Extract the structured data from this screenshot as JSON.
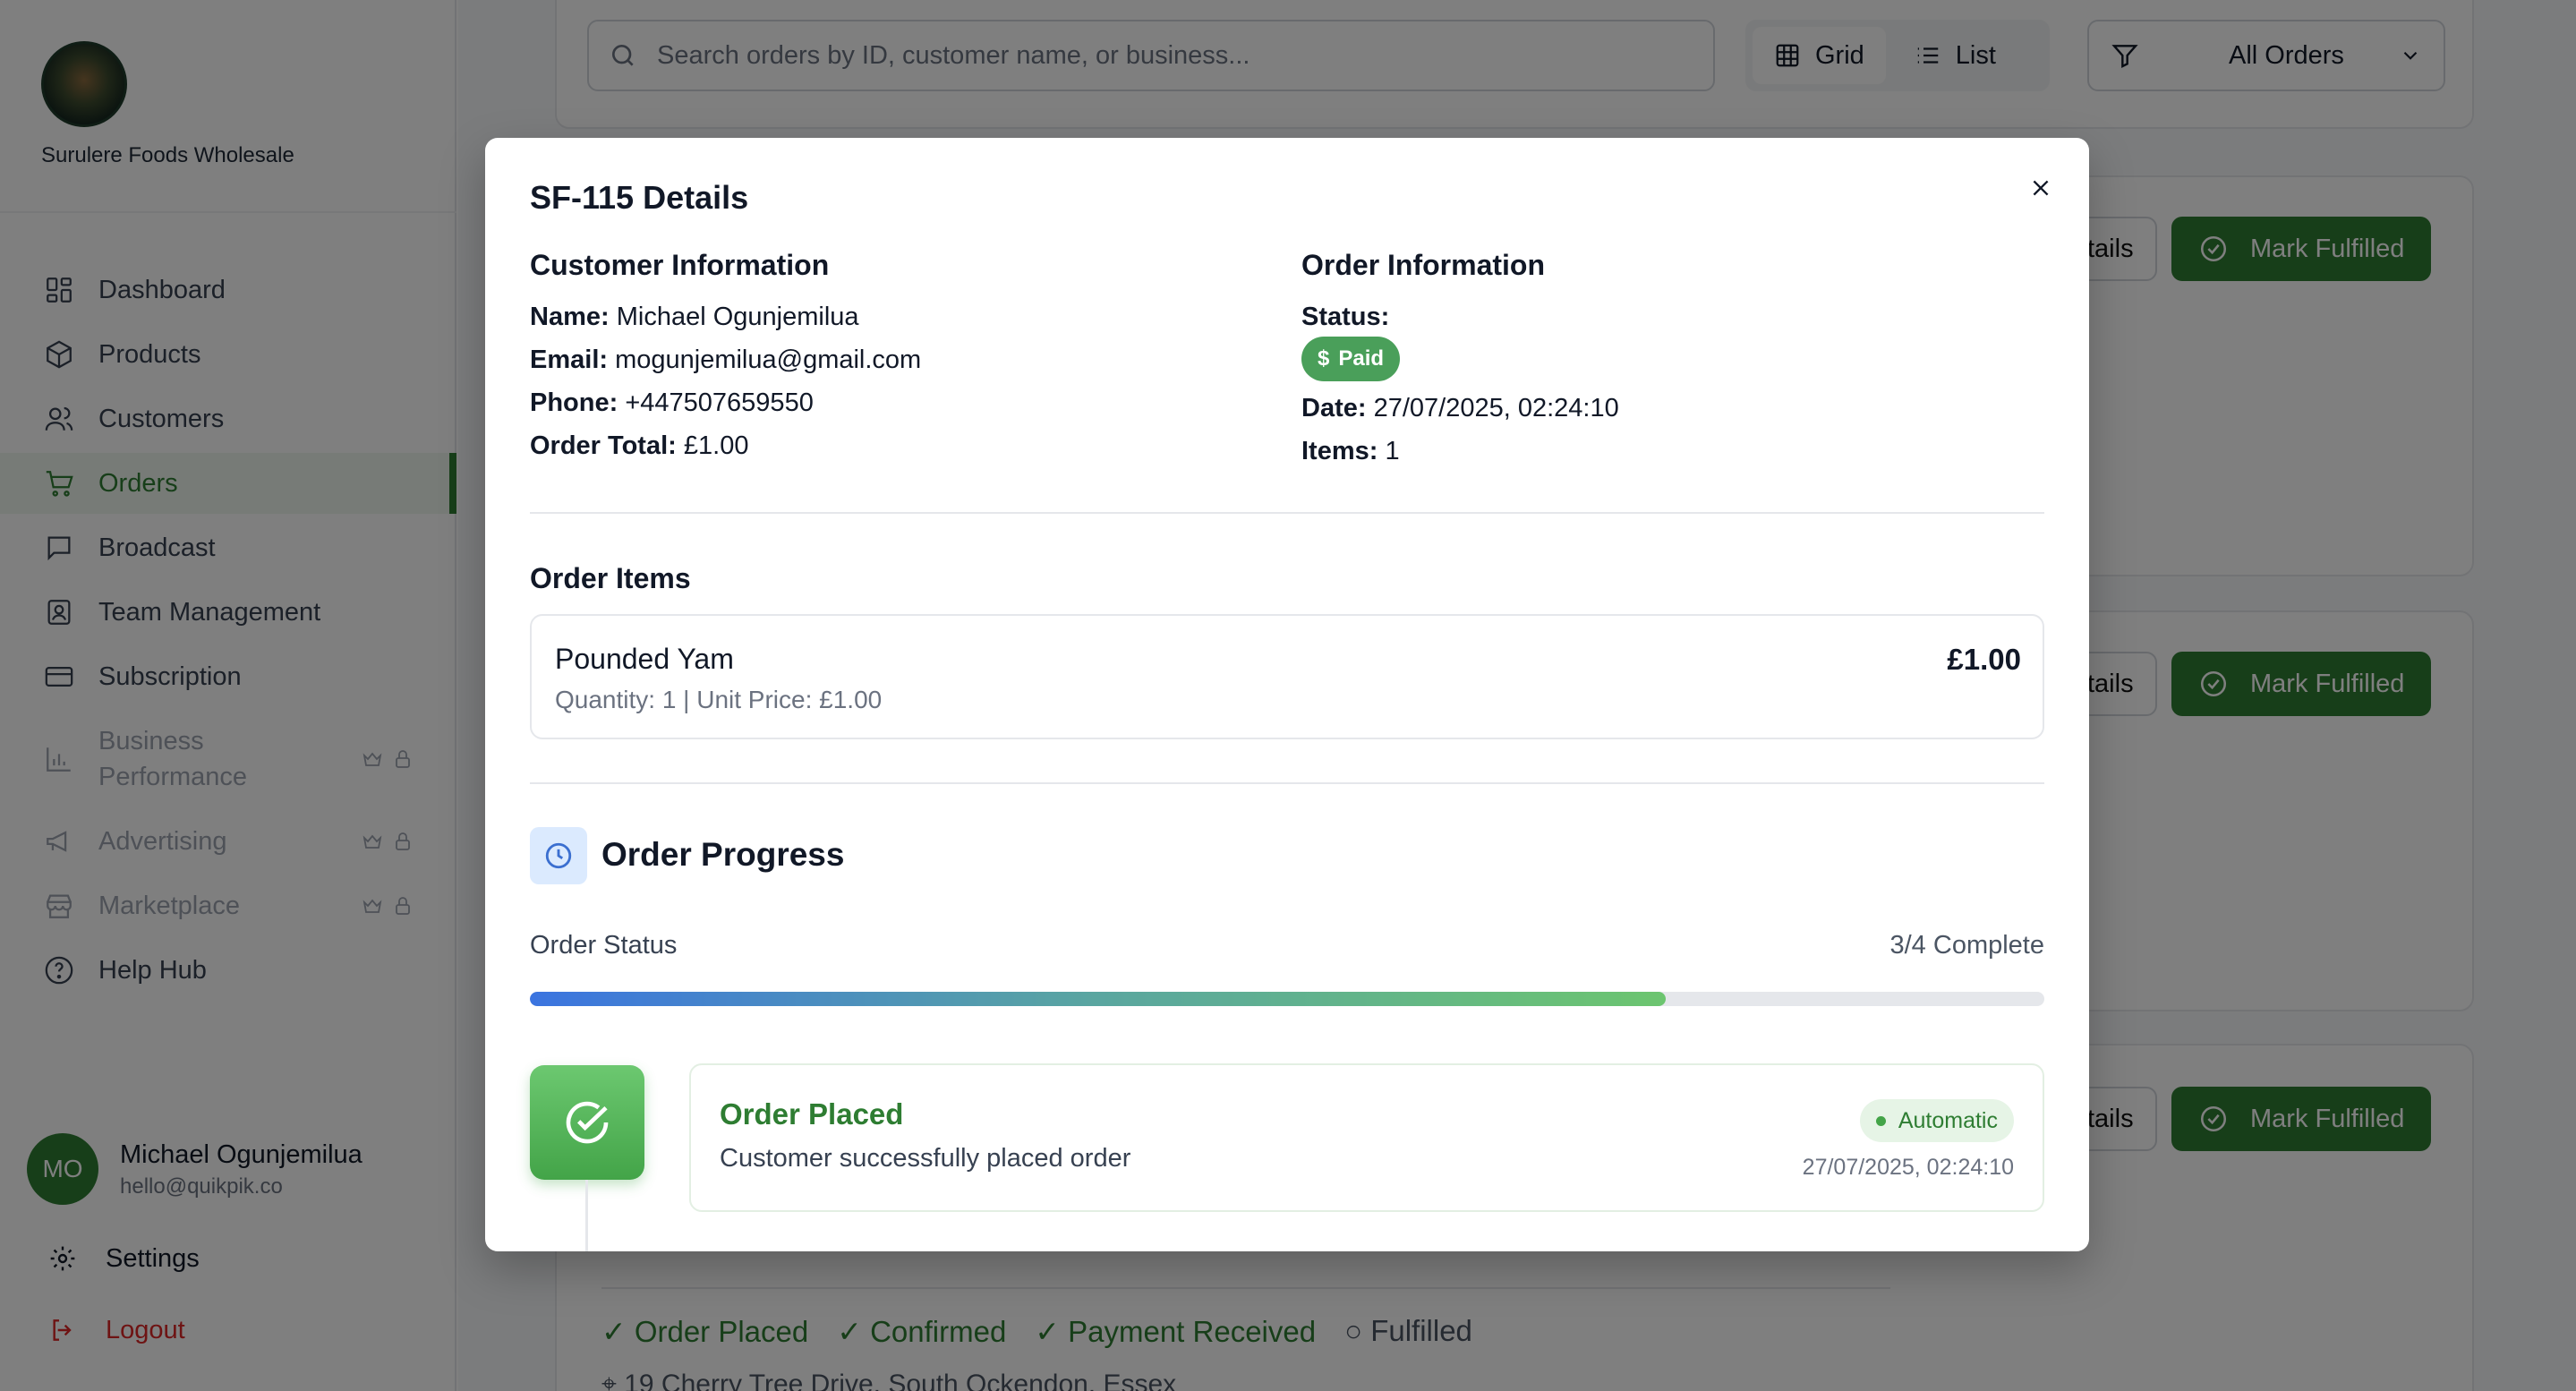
{
  "business": {
    "name": "Surulere Foods Wholesale"
  },
  "nav": {
    "items": [
      {
        "label": "Dashboard",
        "icon": "grid-icon"
      },
      {
        "label": "Products",
        "icon": "box-icon"
      },
      {
        "label": "Customers",
        "icon": "users-icon"
      },
      {
        "label": "Orders",
        "icon": "cart-icon",
        "active": true
      },
      {
        "label": "Broadcast",
        "icon": "message-icon"
      },
      {
        "label": "Team Management",
        "icon": "id-card-icon"
      },
      {
        "label": "Subscription",
        "icon": "credit-card-icon"
      },
      {
        "label": "Business Performance",
        "icon": "bar-chart-icon",
        "locked": true
      },
      {
        "label": "Advertising",
        "icon": "megaphone-icon",
        "locked": true
      },
      {
        "label": "Marketplace",
        "icon": "store-icon",
        "locked": true
      },
      {
        "label": "Help Hub",
        "icon": "help-circle-icon"
      }
    ]
  },
  "user": {
    "initials": "MO",
    "name": "Michael Ogunjemilua",
    "email": "hello@quikpik.co"
  },
  "footer": {
    "settings": "Settings",
    "logout": "Logout"
  },
  "toolbar": {
    "search_placeholder": "Search orders by ID, customer name, or business...",
    "grid_label": "Grid",
    "list_label": "List",
    "filter_value": "All Orders"
  },
  "background_orders": {
    "details_label": "tails",
    "fulfill_label": "Mark Fulfilled",
    "progress_steps": [
      "✓ Order Placed",
      "✓ Confirmed",
      "✓ Payment Received",
      "○ Fulfilled"
    ],
    "address": "⌖ 19 Cherry Tree Drive, South Ockendon, Essex"
  },
  "modal": {
    "title": "SF-115 Details",
    "customer": {
      "heading": "Customer Information",
      "name_label": "Name:",
      "name": "Michael Ogunjemilua",
      "email_label": "Email:",
      "email": "mogunjemilua@gmail.com",
      "phone_label": "Phone:",
      "phone": "+447507659550",
      "total_label": "Order Total:",
      "total": "£1.00"
    },
    "order": {
      "heading": "Order Information",
      "status_label": "Status:",
      "status": "Paid",
      "date_label": "Date:",
      "date": "27/07/2025, 02:24:10",
      "items_label": "Items:",
      "items": "1"
    },
    "items_heading": "Order Items",
    "items": [
      {
        "name": "Pounded Yam",
        "meta": "Quantity: 1 | Unit Price: £1.00",
        "price": "£1.00"
      }
    ],
    "progress": {
      "heading": "Order Progress",
      "status_label": "Order Status",
      "count": "3/4 Complete",
      "fraction": 0.75,
      "step": {
        "title": "Order Placed",
        "description": "Customer successfully placed order",
        "badge": "Automatic",
        "time": "27/07/2025, 02:24:10"
      }
    }
  },
  "colors": {
    "brand": "#2e7d32",
    "paid": "#4a9f5a",
    "logout": "#dc2626"
  }
}
